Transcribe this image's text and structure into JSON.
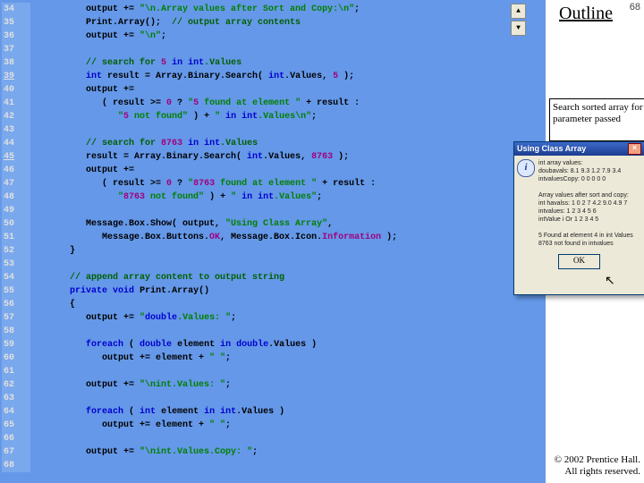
{
  "slide_number": "68",
  "outline_label": "Outline",
  "annotation": "Search sorted array for parameter passed",
  "dialog": {
    "title": "Using Class Array",
    "body": "int array values:\ndoubavals: 8.1 9.3 1.2 7.9 3.4\nintvaluesCopy: 0 0 0 0 0\n\nArray values after sort and copy:\nint havalss: 1 0 2 7 4.2 9.0 4.9 7\nintvalues: 1 2 3 4 5 6\nintValue i Or 1 2 3 4 5\n\n5 Found at element 4 in int Values\n8763 not found in intvalues",
    "ok": "OK"
  },
  "copyright": "© 2002 Prentice Hall.\nAll rights reserved.",
  "lines": [
    {
      "n": "34",
      "c": "         output += \"\\n.Array values after Sort and Copy:\\n\";"
    },
    {
      "n": "35",
      "c": "         Print.Array();  // output array contents"
    },
    {
      "n": "36",
      "c": "         output += \"\\n\";"
    },
    {
      "n": "37",
      "c": ""
    },
    {
      "n": "38",
      "c": "         // search for 5 in int.Values"
    },
    {
      "n": "39",
      "c": "         int result = Array.Binary.Search( int.Values, 5 );",
      "u": true
    },
    {
      "n": "40",
      "c": "         output +="
    },
    {
      "n": "41",
      "c": "            ( result >= 0 ? \"5 found at element \" + result :"
    },
    {
      "n": "42",
      "c": "               \"5 not found\" ) + \" in int.Values\\n\";"
    },
    {
      "n": "43",
      "c": ""
    },
    {
      "n": "44",
      "c": "         // search for 8763 in int.Values"
    },
    {
      "n": "45",
      "c": "         result = Array.Binary.Search( int.Values, 8763 );",
      "u": true
    },
    {
      "n": "46",
      "c": "         output +="
    },
    {
      "n": "47",
      "c": "            ( result >= 0 ? \"8763 found at element \" + result :"
    },
    {
      "n": "48",
      "c": "               \"8763 not found\" ) + \" in int.Values\";"
    },
    {
      "n": "49",
      "c": ""
    },
    {
      "n": "50",
      "c": "         Message.Box.Show( output, \"Using Class Array\","
    },
    {
      "n": "51",
      "c": "            Message.Box.Buttons.OK, Message.Box.Icon.Information );"
    },
    {
      "n": "52",
      "c": "      }"
    },
    {
      "n": "53",
      "c": ""
    },
    {
      "n": "54",
      "c": "      // append array content to output string"
    },
    {
      "n": "55",
      "c": "      private void Print.Array()"
    },
    {
      "n": "56",
      "c": "      {"
    },
    {
      "n": "57",
      "c": "         output += \"double.Values: \";"
    },
    {
      "n": "58",
      "c": ""
    },
    {
      "n": "59",
      "c": "         foreach ( double element in double.Values )"
    },
    {
      "n": "60",
      "c": "            output += element + \" \";"
    },
    {
      "n": "61",
      "c": ""
    },
    {
      "n": "62",
      "c": "         output += \"\\nint.Values: \";"
    },
    {
      "n": "63",
      "c": ""
    },
    {
      "n": "64",
      "c": "         foreach ( int element in int.Values )"
    },
    {
      "n": "65",
      "c": "            output += element + \" \";"
    },
    {
      "n": "66",
      "c": ""
    },
    {
      "n": "67",
      "c": "         output += \"\\nint.Values.Copy: \";"
    },
    {
      "n": "68",
      "c": ""
    }
  ]
}
